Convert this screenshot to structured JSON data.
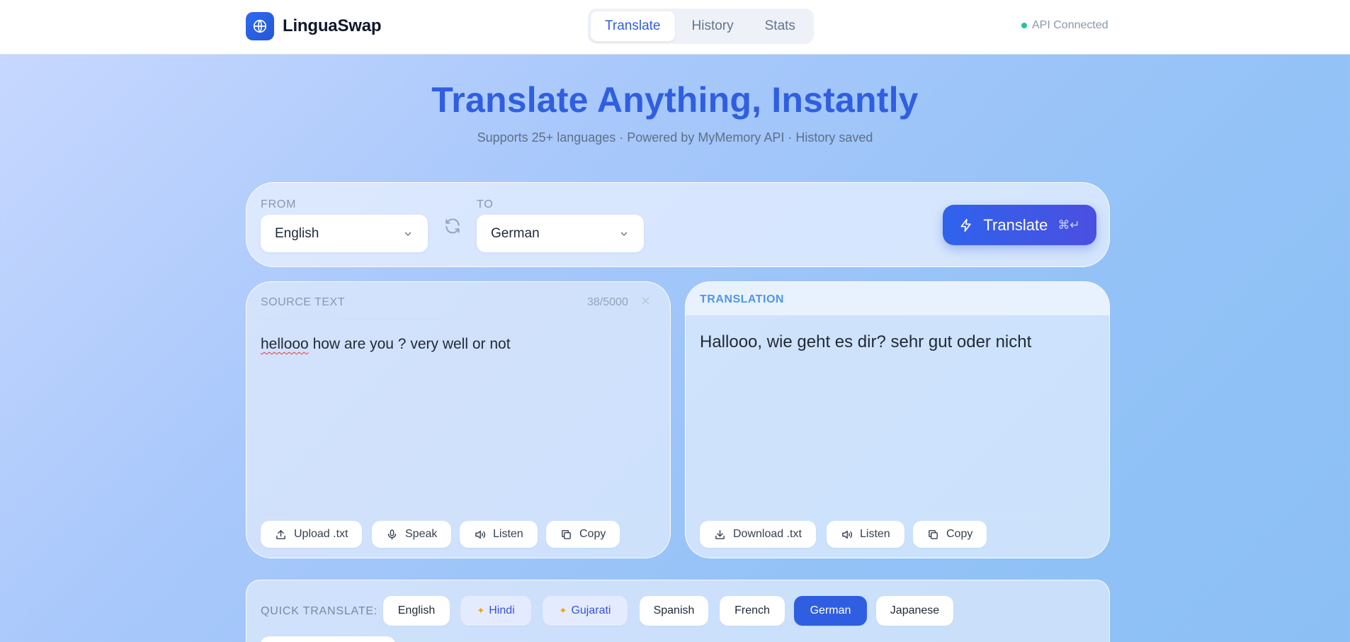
{
  "header": {
    "brand_name": "LinguaSwap",
    "tabs": [
      {
        "label": "Translate",
        "active": true
      },
      {
        "label": "History",
        "active": false
      },
      {
        "label": "Stats",
        "active": false
      }
    ],
    "api_status": "API Connected",
    "status_color": "#22c59a"
  },
  "hero": {
    "title": "Translate Anything, Instantly",
    "subtitle": "Supports 25+ languages · Powered by MyMemory API · History saved"
  },
  "languages": {
    "from_label": "FROM",
    "from_value": "English",
    "to_label": "TO",
    "to_value": "German",
    "translate_label": "Translate",
    "shortcut": "⌘↵"
  },
  "source": {
    "title": "SOURCE TEXT",
    "counter": "38/5000",
    "misspelled_word": "hellooo",
    "text_rest": " how are you ? very well or not",
    "buttons": {
      "upload": "Upload .txt",
      "speak": "Speak",
      "listen": "Listen",
      "copy": "Copy"
    }
  },
  "translation": {
    "title": "TRANSLATION",
    "text": "Hallooo, wie geht es dir? sehr gut oder nicht",
    "buttons": {
      "download": "Download .txt",
      "listen": "Listen",
      "copy": "Copy"
    }
  },
  "quick": {
    "label": "QUICK TRANSLATE:",
    "chips": [
      {
        "label": "English"
      },
      {
        "label": "Hindi",
        "favorite": true
      },
      {
        "label": "Gujarati",
        "favorite": true
      },
      {
        "label": "Spanish"
      },
      {
        "label": "French"
      },
      {
        "label": "German",
        "active": true
      },
      {
        "label": "Japanese"
      }
    ]
  },
  "colors": {
    "accent": "#2f5fe0",
    "brand": "#2f6bf0"
  }
}
